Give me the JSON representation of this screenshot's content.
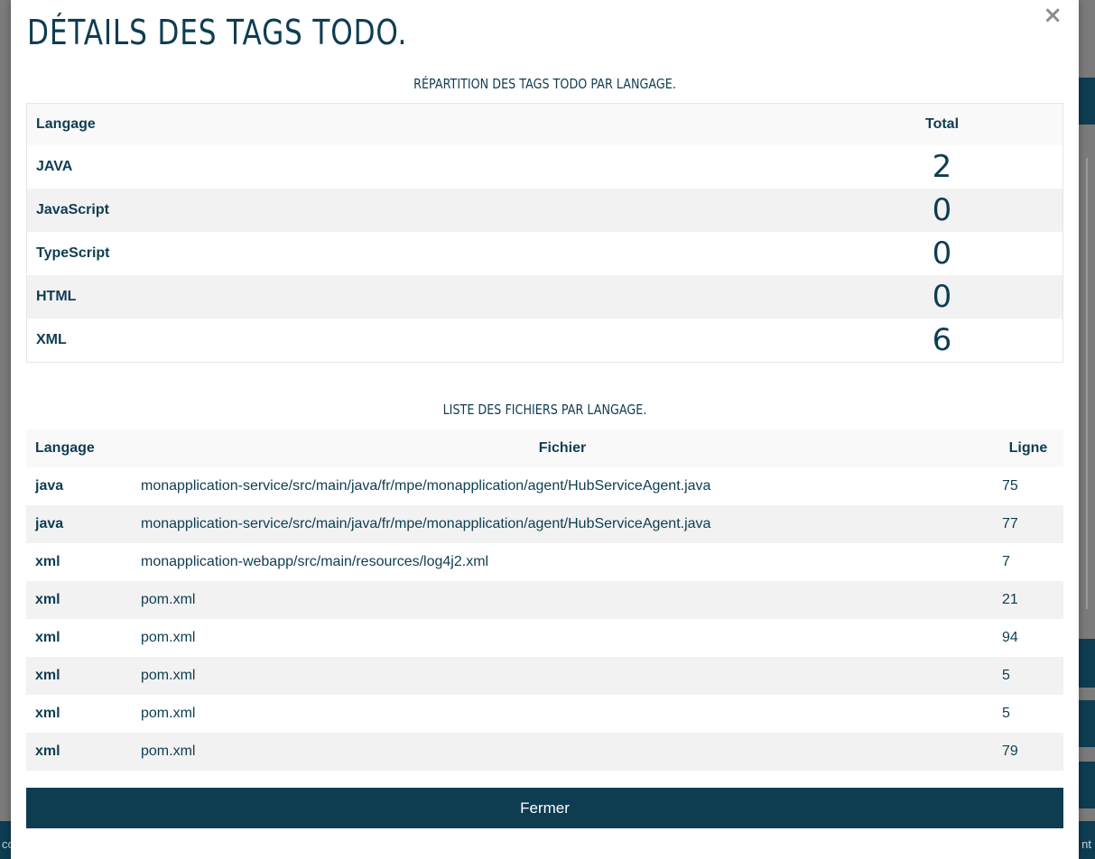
{
  "background": {
    "footer_left": "co",
    "footer_right": "nt"
  },
  "modal": {
    "title": "Détails des tags TODO.",
    "close_icon": "×",
    "close_button_label": "Fermer",
    "colors": {
      "primary": "#0e3d52",
      "stripe": "#f2f2f2"
    }
  },
  "summary": {
    "title": "Répartition des tags TODO par langage.",
    "headers": {
      "language": "Langage",
      "total": "Total"
    },
    "rows": [
      {
        "language": "JAVA",
        "total": "2"
      },
      {
        "language": "JavaScript",
        "total": "0"
      },
      {
        "language": "TypeScript",
        "total": "0"
      },
      {
        "language": "HTML",
        "total": "0"
      },
      {
        "language": "XML",
        "total": "6"
      }
    ]
  },
  "files": {
    "title": "Liste des fichiers par langage.",
    "headers": {
      "language": "Langage",
      "file": "Fichier",
      "line": "Ligne"
    },
    "rows": [
      {
        "language": "java",
        "file": "monapplication-service/src/main/java/fr/mpe/monapplication/agent/HubServiceAgent.java",
        "line": "75"
      },
      {
        "language": "java",
        "file": "monapplication-service/src/main/java/fr/mpe/monapplication/agent/HubServiceAgent.java",
        "line": "77"
      },
      {
        "language": "xml",
        "file": "monapplication-webapp/src/main/resources/log4j2.xml",
        "line": "7"
      },
      {
        "language": "xml",
        "file": "pom.xml",
        "line": "21"
      },
      {
        "language": "xml",
        "file": "pom.xml",
        "line": "94"
      },
      {
        "language": "xml",
        "file": "pom.xml",
        "line": "5"
      },
      {
        "language": "xml",
        "file": "pom.xml",
        "line": "5"
      },
      {
        "language": "xml",
        "file": "pom.xml",
        "line": "79"
      }
    ]
  }
}
